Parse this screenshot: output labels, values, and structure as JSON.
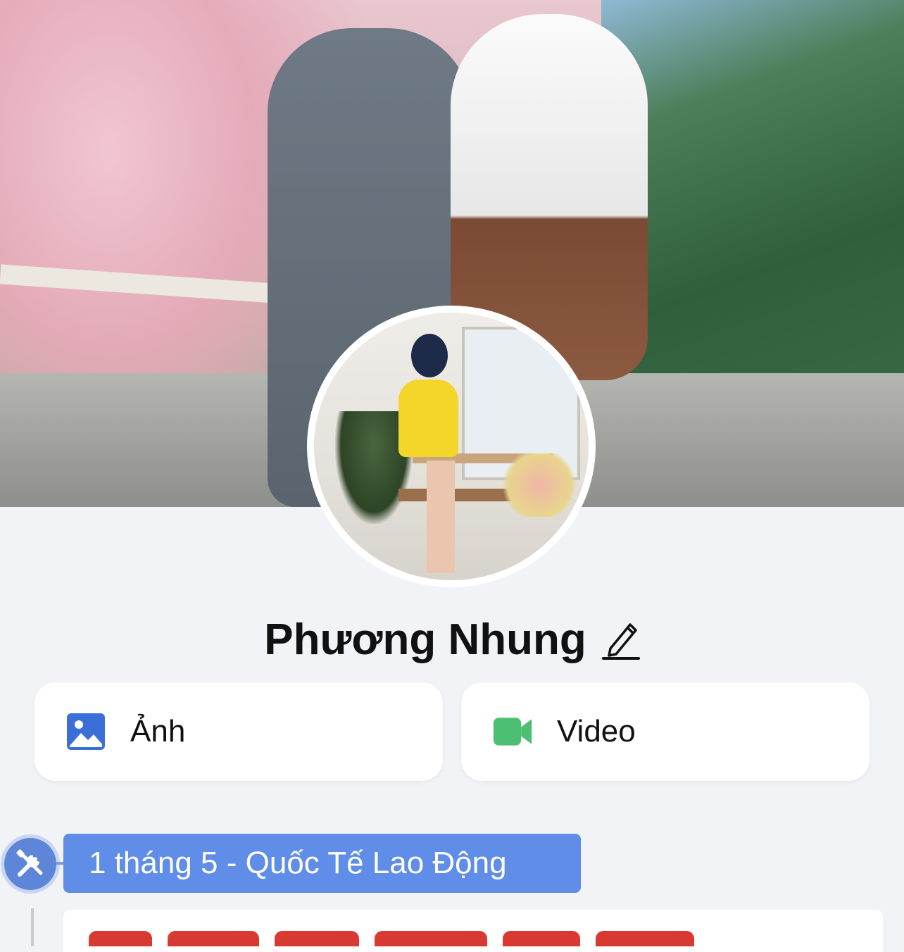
{
  "profile": {
    "name": "Phương Nhung"
  },
  "media_buttons": {
    "photo_label": "Ảnh",
    "video_label": "Video"
  },
  "event": {
    "title": "1 tháng 5 - Quốc Tế Lao Động"
  },
  "icons": {
    "edit": "pencil-icon",
    "photo": "image-icon",
    "video": "video-camera-icon",
    "event": "tools-icon"
  },
  "colors": {
    "background": "#f2f3f7",
    "photo_icon": "#3a6fd8",
    "video_icon": "#4cbf72",
    "event_tag": "#5f8de8",
    "post_text": "#d83a32"
  }
}
